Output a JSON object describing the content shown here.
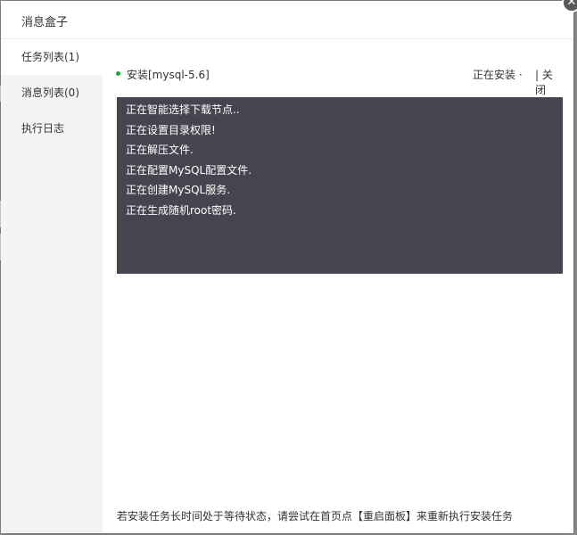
{
  "dialog": {
    "title": "消息盒子",
    "close_symbol": "✕"
  },
  "sidebar": {
    "items": [
      {
        "label": "任务列表(1)",
        "active": true
      },
      {
        "label": "消息列表(0)",
        "active": false
      },
      {
        "label": "执行日志",
        "active": false
      }
    ]
  },
  "task": {
    "name": "安装[mysql-5.6]",
    "status": "正在安装 ·",
    "close_label": "| 关闭",
    "status_color": "#20a53a"
  },
  "log": {
    "lines": [
      "正在智能选择下载节点..",
      "正在设置目录权限!",
      "正在解压文件.",
      "正在配置MySQL配置文件.",
      "正在创建MySQL服务.",
      "正在生成随机root密码."
    ]
  },
  "footer": {
    "tip": "若安装任务长时间处于等待状态，请尝试在首页点【重启面板】来重新执行安装任务"
  }
}
